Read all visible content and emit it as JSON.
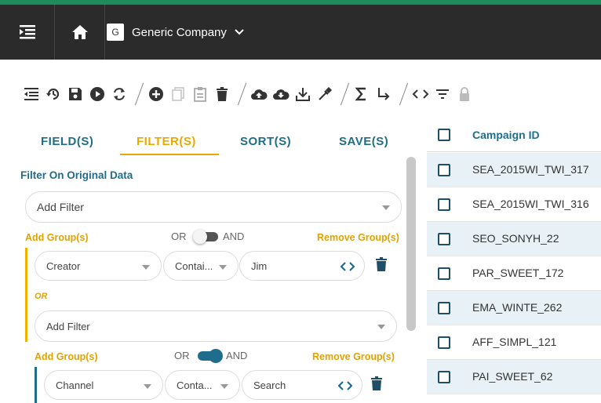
{
  "topbar": {
    "company_badge": "G",
    "company_name": "Generic Company",
    "icons": [
      "menu-collapse-icon",
      "home-icon",
      "chevron-down-icon"
    ],
    "accent": "#1e8c5a"
  },
  "toolbar": {
    "icons": [
      "indent-icon",
      "history-icon",
      "save-icon",
      "play-icon",
      "refresh-icon",
      "add-icon",
      "copy-icon",
      "paste-icon",
      "delete-icon",
      "cloud-upload-icon",
      "cloud-download-icon",
      "download-icon",
      "eyedropper-icon",
      "sigma-icon",
      "arrow-turn-icon",
      "code-icon",
      "filter-lines-icon",
      "lock-icon"
    ]
  },
  "tabs": [
    {
      "label": "FIELD(S)",
      "active": false
    },
    {
      "label": "FILTER(S)",
      "active": true
    },
    {
      "label": "SORT(S)",
      "active": false
    },
    {
      "label": "SAVE(S)",
      "active": false
    }
  ],
  "filter_panel": {
    "section_title": "Filter On Original Data",
    "add_filter_placeholder": "Add Filter",
    "groups": [
      {
        "add_group_label": "Add Group(s)",
        "remove_group_label": "Remove Group(s)",
        "toggle_or": "OR",
        "toggle_and": "AND",
        "toggle_state": "OR",
        "field": "Creator",
        "operator": "Contai...",
        "value": "Jim",
        "or_label": "OR",
        "add_filter_placeholder": "Add Filter",
        "bar_color": "#f0b400"
      },
      {
        "add_group_label": "Add Group(s)",
        "remove_group_label": "Remove Group(s)",
        "toggle_or": "OR",
        "toggle_and": "AND",
        "toggle_state": "AND",
        "field": "Channel",
        "operator": "Conta...",
        "value": "Search",
        "bar_color": "#1f6d8c"
      }
    ]
  },
  "table": {
    "header": "Campaign ID",
    "rows": [
      "SEA_2015WI_TWI_317",
      "SEA_2015WI_TWI_316",
      "SEO_SONYH_22",
      "PAR_SWEET_172",
      "EMA_WINTE_262",
      "AFF_SIMPL_121",
      "PAI_SWEET_62"
    ],
    "alt_row_color": "#e8f1f6"
  }
}
